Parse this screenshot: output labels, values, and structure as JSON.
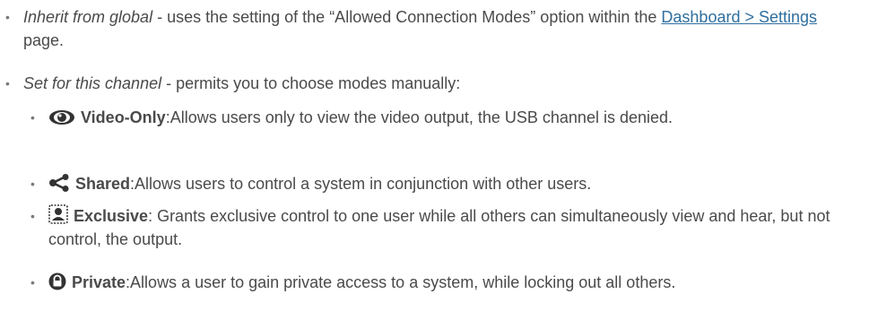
{
  "items": [
    {
      "term": "Inherit from global",
      "text_before_link": " - uses the setting of the “Allowed Connection Modes” option within the ",
      "link": "Dashboard > Settings",
      "text_after_link": " page."
    },
    {
      "term": "Set for this channel",
      "text": " - permits you to choose modes manually:",
      "modes": [
        {
          "icon": "eye-icon",
          "label": "Video-Only",
          "text": ":Allows users only to view the video output, the USB channel is denied."
        },
        {
          "icon": "share-icon",
          "label": "Shared",
          "text": ":Allows users to control a system in conjunction with other users."
        },
        {
          "icon": "exclusive-user-icon",
          "label": "Exclusive",
          "text": ": Grants exclusive control to one user while all others can simultaneously view and hear, but not control, the output."
        },
        {
          "icon": "lock-icon",
          "label": "Private",
          "text": ":Allows a user to gain private access to a system, while locking out all others."
        }
      ]
    }
  ],
  "bullet_char": "•",
  "colors": {
    "text": "#4a4a4a",
    "link": "#2f6f9f",
    "icon": "#333333"
  }
}
